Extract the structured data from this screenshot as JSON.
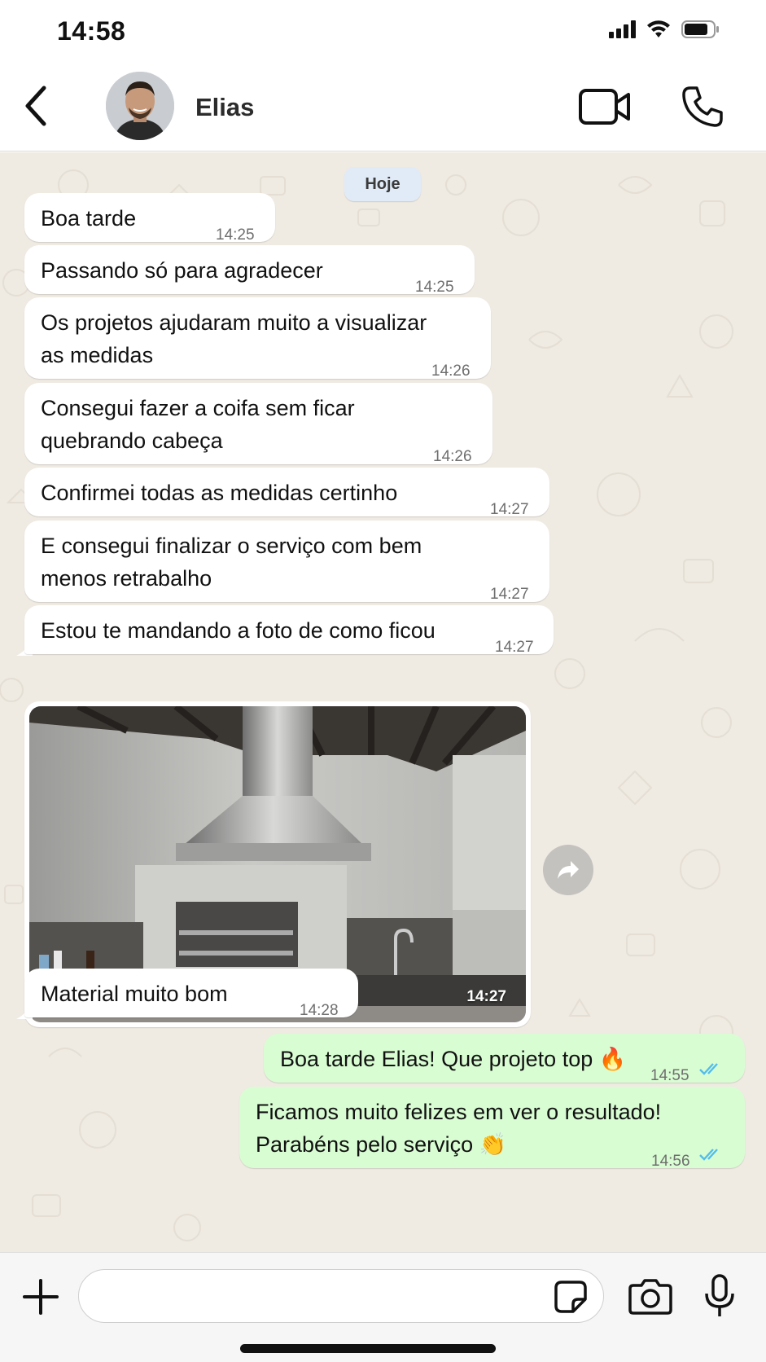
{
  "status_bar": {
    "time": "14:58",
    "icons": [
      "signal-icon",
      "wifi-icon",
      "battery-icon"
    ]
  },
  "header": {
    "contact_name": "Elias",
    "icons": [
      "back-chevron-icon",
      "video-call-icon",
      "phone-icon"
    ]
  },
  "chat": {
    "date_chip": "Hoje",
    "messages": [
      {
        "text": "Boa tarde",
        "time": "14:25",
        "direction": "in"
      },
      {
        "text": "Passando só para agradecer",
        "time": "14:25",
        "direction": "in"
      },
      {
        "text": "Os projetos ajudaram muito a visualizar\nas medidas",
        "time": "14:26",
        "direction": "in"
      },
      {
        "text": "Consegui fazer a coifa sem ficar\nquebrando cabeça",
        "time": "14:26",
        "direction": "in"
      },
      {
        "text": "Confirmei todas as medidas certinho",
        "time": "14:27",
        "direction": "in"
      },
      {
        "text": "E consegui finalizar o serviço com bem\nmenos retrabalho",
        "time": "14:27",
        "direction": "in"
      },
      {
        "text": "Estou te mandando a foto de como ficou",
        "time": "14:27",
        "direction": "in"
      },
      {
        "type": "image",
        "time": "14:27",
        "direction": "in",
        "image_subject": "cozinha gourmet com coifa de inox e churrasqueira"
      },
      {
        "text": "Material muito bom",
        "time": "14:28",
        "direction": "in"
      },
      {
        "text": "Boa tarde Elias! Que projeto top 🔥",
        "time": "14:55",
        "direction": "out",
        "status": "read"
      },
      {
        "text": "Ficamos muito felizes em ver o resultado!\nParabéns pelo serviço 👏",
        "time": "14:56",
        "direction": "out",
        "status": "read"
      }
    ]
  },
  "composer": {
    "placeholder": "",
    "icons": [
      "plus-icon",
      "sticker-icon",
      "camera-icon",
      "microphone-icon"
    ]
  },
  "colors": {
    "chat_background": "#efeae2",
    "incoming_bubble": "#ffffff",
    "outgoing_bubble": "#d9fdd3",
    "read_ticks": "#53bdeb",
    "date_chip": "#e1ebf7"
  }
}
